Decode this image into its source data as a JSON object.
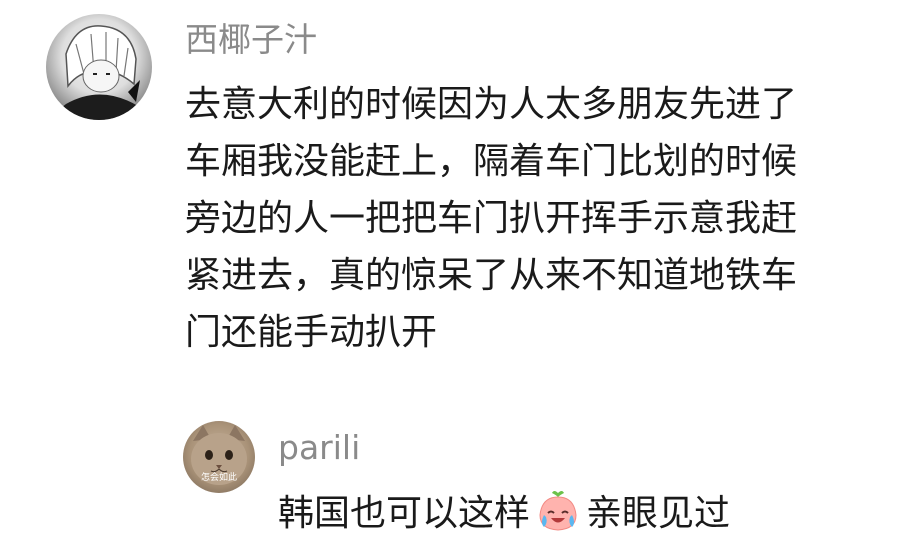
{
  "comment": {
    "username": "西椰子汁",
    "avatar_icon": "anime-avatar-icon",
    "lines": [
      "去意大利的时候因为人太多朋友先进了",
      "车厢我没能赶上，隔着车门比划的时候",
      "旁边的人一把把车门扒开挥手示意我赶",
      "紧进去，真的惊呆了从来不知道地铁车",
      "门还能手动扒开"
    ]
  },
  "reply": {
    "username": "parili",
    "avatar_icon": "cat-avatar-icon",
    "avatar_caption": "怎会如此",
    "text_before": "韩国也可以这样",
    "emoji_icon": "crying-laughing-peach-emoji-icon",
    "text_after": "亲眼见过"
  }
}
